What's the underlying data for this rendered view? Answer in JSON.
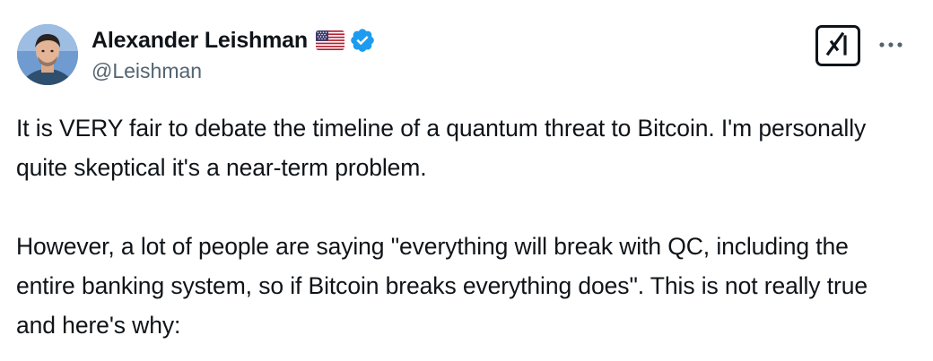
{
  "author": {
    "display_name": "Alexander Leishman",
    "handle": "@Leishman",
    "flag_icon": "us-flag-icon",
    "verified_icon": "verified-badge-icon",
    "verified_color": "#1d9bf0"
  },
  "actions": {
    "grok_icon": "grok-icon",
    "more_icon": "more-options-icon"
  },
  "tweet": {
    "paragraphs": [
      "It is VERY fair to debate the timeline of a quantum threat to Bitcoin. I'm personally quite skeptical it's a near-term problem.",
      "However, a lot of people are saying \"everything will break with QC, including the entire banking system, so if Bitcoin breaks everything does\". This is not really true and here's why:"
    ]
  },
  "colors": {
    "text": "#0f1419",
    "secondary": "#536471",
    "accent": "#1d9bf0"
  }
}
